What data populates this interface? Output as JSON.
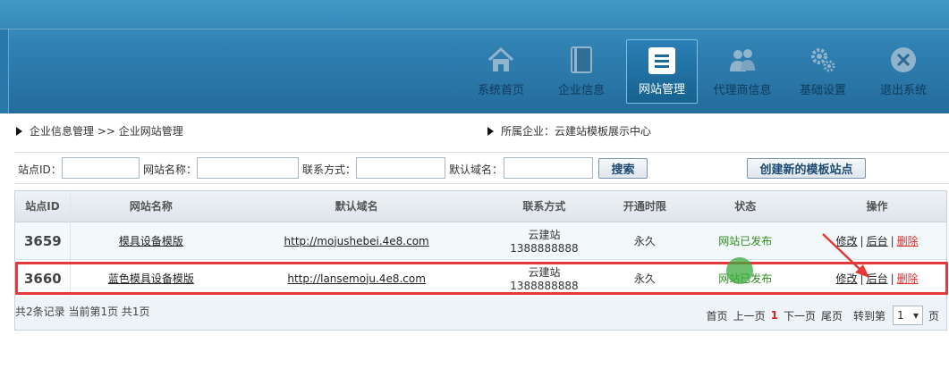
{
  "nav": {
    "items": [
      {
        "label": "系统首页",
        "icon": "house-icon"
      },
      {
        "label": "企业信息",
        "icon": "book-icon"
      },
      {
        "label": "网站管理",
        "icon": "list-icon",
        "active": true
      },
      {
        "label": "代理商信息",
        "icon": "users-icon"
      },
      {
        "label": "基础设置",
        "icon": "gears-icon"
      },
      {
        "label": "退出系统",
        "icon": "close-circle-icon"
      }
    ]
  },
  "breadcrumb": {
    "path": "企业信息管理 >> 企业网站管理",
    "company": "所属企业：云建站模板展示中心"
  },
  "search": {
    "station_id_label": "站点ID：",
    "site_name_label": "网站名称：",
    "contact_label": "联系方式：",
    "domain_label": "默认域名：",
    "station_id_value": "",
    "site_name_value": "",
    "contact_value": "",
    "domain_value": "",
    "search_button": "搜索",
    "create_button": "创建新的模板站点"
  },
  "table": {
    "headers": [
      "站点ID",
      "网站名称",
      "默认域名",
      "联系方式",
      "开通时限",
      "状态",
      "操作"
    ],
    "rows": [
      {
        "id": "3659",
        "name": "模具设备模版",
        "domain": "http://mojushebei.4e8.com",
        "contact_name": "云建站",
        "contact_phone": "1388888888",
        "term": "永久",
        "status": "网站已发布",
        "edit": "修改",
        "admin": "后台",
        "delete": "删除"
      },
      {
        "id": "3660",
        "name": "蓝色模具设备模版",
        "domain": "http://lansemoju.4e8.com",
        "contact_name": "云建站",
        "contact_phone": "1388888888",
        "term": "永久",
        "status": "网站已发布",
        "edit": "修改",
        "admin": "后台",
        "delete": "删除"
      }
    ]
  },
  "pagination": {
    "summary": "共2条记录 当前第1页 共1页",
    "first": "首页",
    "prev": "上一页",
    "current": "1",
    "next": "下一页",
    "last": "尾页",
    "goto_prefix": "转到第",
    "goto_value": "1",
    "goto_suffix": "页"
  },
  "colors": {
    "header": "#2f7fb0",
    "highlight": "#e23a3a",
    "status_green": "#2e8b1e",
    "delete_red": "#e03030"
  }
}
